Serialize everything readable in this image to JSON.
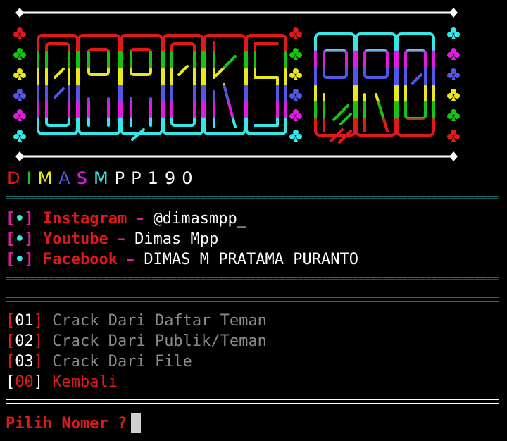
{
  "banner": {
    "logo_text": "CRACKS PRO",
    "colors": [
      "#e21919",
      "#13c613",
      "#e8e81a",
      "#5555e8",
      "#e21be2",
      "#35e8e8"
    ]
  },
  "author": {
    "letters": [
      {
        "ch": "D",
        "color": "#e21919"
      },
      {
        "ch": "I",
        "color": "#13c613"
      },
      {
        "ch": "M",
        "color": "#e8e81a"
      },
      {
        "ch": "A",
        "color": "#5555e8"
      },
      {
        "ch": "S",
        "color": "#e21be2"
      },
      {
        "ch": "M",
        "color": "#35e8e8"
      },
      {
        "ch": "P",
        "color": "#ffffff"
      },
      {
        "ch": "P",
        "color": "#ffffff"
      },
      {
        "ch": "1",
        "color": "#ffffff"
      },
      {
        "ch": "9",
        "color": "#ffffff"
      },
      {
        "ch": "0",
        "color": "#ffffff"
      }
    ]
  },
  "rules": {
    "separator": "========================================================================================"
  },
  "socials": [
    {
      "bracket_open": "[",
      "dot": "•",
      "bracket_close": "]",
      "name": "Instagram",
      "arrow": "➡",
      "value": "@dimasmpp_"
    },
    {
      "bracket_open": "[",
      "dot": "•",
      "bracket_close": "]",
      "name": "Youtube",
      "arrow": "➡",
      "value": "Dimas Mpp"
    },
    {
      "bracket_open": "[",
      "dot": "•",
      "bracket_close": "]",
      "name": "Facebook",
      "arrow": "➡",
      "value": "DIMAS M PRATAMA PURANTO"
    }
  ],
  "menu": [
    {
      "open": "[",
      "num": "01",
      "close": "]",
      "label": "Crack Dari Daftar Teman"
    },
    {
      "open": "[",
      "num": "02",
      "close": "]",
      "label": "Crack Dari Publik/Teman"
    },
    {
      "open": "[",
      "num": "03",
      "close": "]",
      "label": "Crack Dari File"
    },
    {
      "open": "[",
      "num": "00",
      "close": "]",
      "label": "Kembali"
    }
  ],
  "prompt": {
    "text": "Pilih Nomer ?"
  },
  "colors": {
    "background": "#000000",
    "red": "#e21919",
    "magenta": "#e21b9c",
    "cyan": "#35e8e8",
    "gray": "#8a8a8a"
  }
}
